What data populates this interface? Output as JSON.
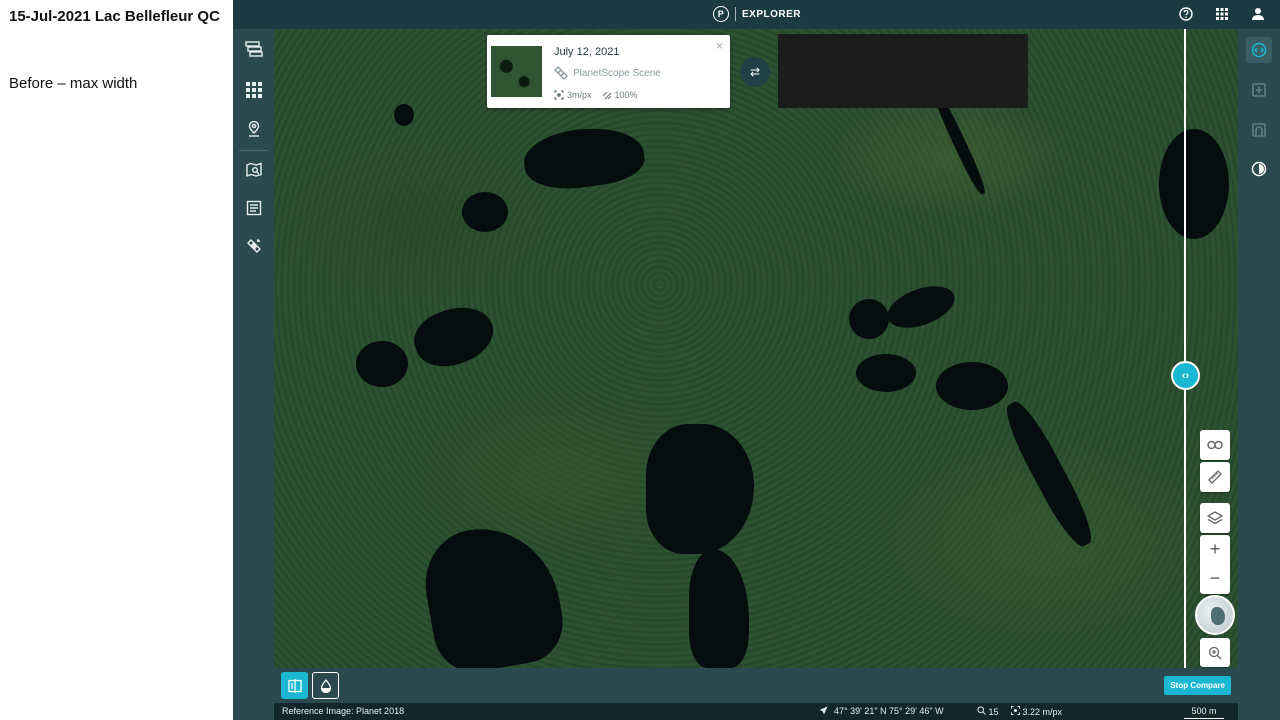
{
  "slide": {
    "title": "15-Jul-2021 Lac Bellefleur QC",
    "caption": "Before – max width"
  },
  "app": {
    "brand_logo": "P",
    "brand_name": "EXPLORER",
    "top_icons": [
      "help-icon",
      "apps-grid-icon",
      "user-icon"
    ]
  },
  "scene_card": {
    "date": "July 12, 2021",
    "type": "PlanetScope Scene",
    "resolution": "3m/px",
    "coverage": "100%",
    "close": "×"
  },
  "swap": "⇄",
  "compare_handle": "‹›",
  "map_controls": {
    "zoom_in": "+",
    "zoom_out": "−"
  },
  "bottom": {
    "stop_compare": "Stop Compare"
  },
  "status": {
    "reference_image": "Reference Image: Planet 2018",
    "coordinates": "47° 39' 21\" N 75° 29' 46\" W",
    "zoom": "15",
    "resolution": "3.22 m/px",
    "scale": "500 m"
  },
  "colors": {
    "accent": "#1ab7d3",
    "topbar": "#1b3a42",
    "sidebar": "#2a4a50",
    "status": "#12262b"
  }
}
